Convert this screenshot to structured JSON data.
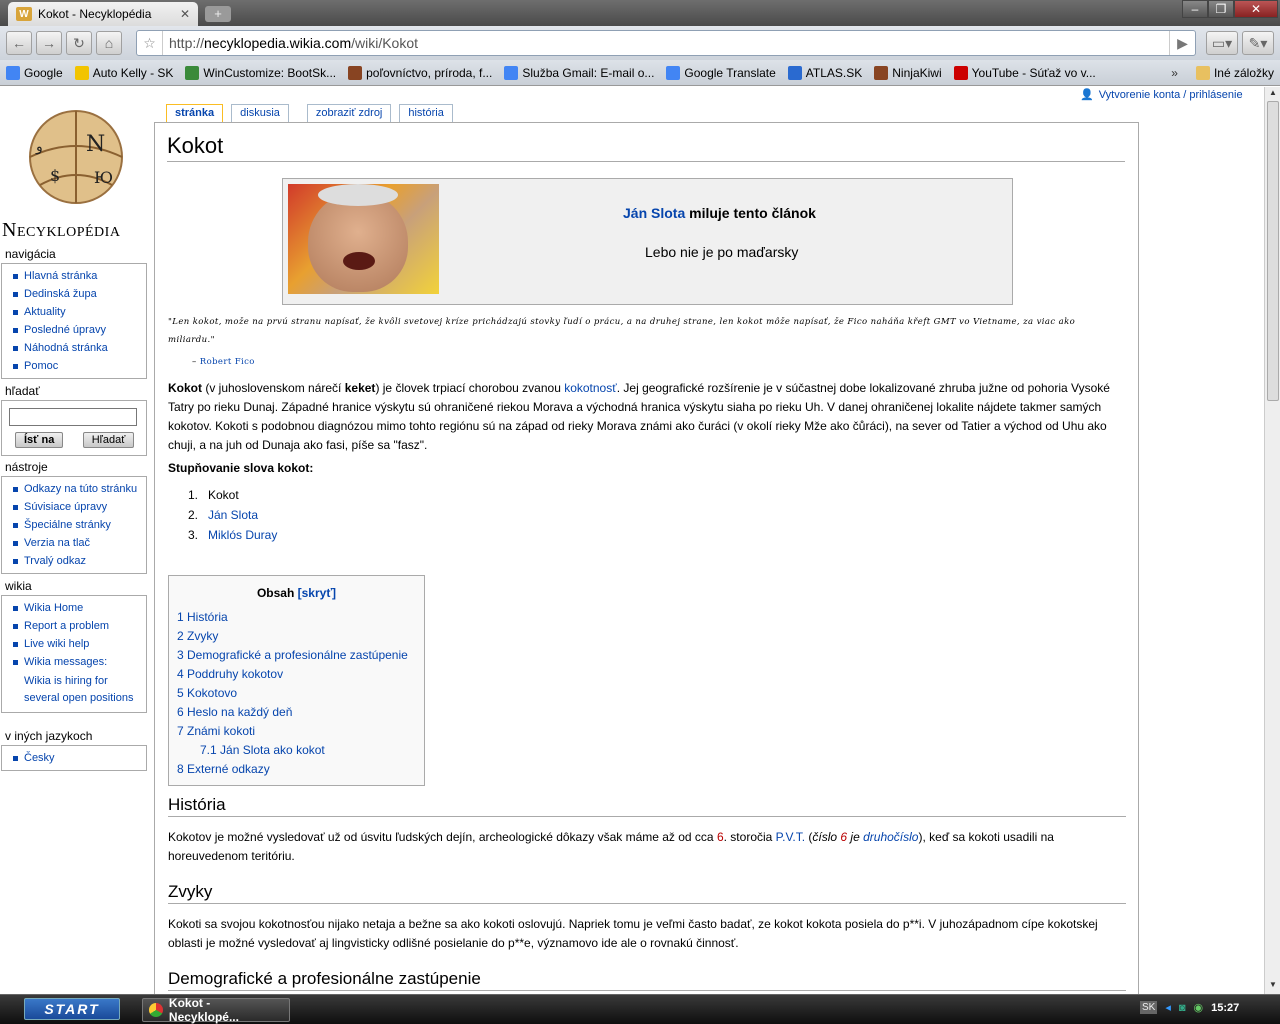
{
  "browser": {
    "tab_title": "Kokot - Necyklopédia",
    "tab_favicon": "W",
    "url_prefix": "http://",
    "url_domain": "necyklopedia.wikia.com",
    "url_path": "/wiki/Kokot"
  },
  "bookmarks": [
    {
      "label": "Google",
      "color": "#4285f4"
    },
    {
      "label": "Auto Kelly - SK",
      "color": "#f2c400"
    },
    {
      "label": "WinCustomize: BootSk...",
      "color": "#3a8a3a"
    },
    {
      "label": "poľovníctvo, príroda, f...",
      "color": "#884422"
    },
    {
      "label": "Služba Gmail: E-mail o...",
      "color": "#4285f4"
    },
    {
      "label": "Google Translate",
      "color": "#4285f4"
    },
    {
      "label": "ATLAS.SK",
      "color": "#2a6ad0"
    },
    {
      "label": "NinjaKiwi",
      "color": "#884422"
    },
    {
      "label": "YouTube - Súťaž vo v...",
      "color": "#cc0000"
    }
  ],
  "bookmarks_other": "Iné záložky",
  "user_links": "Vytvorenie konta / prihlásenie",
  "logo_text": "Necyklopédia",
  "sidebar": {
    "nav_title": "navigácia",
    "nav_items": [
      "Hlavná stránka",
      "Dedinská župa",
      "Aktuality",
      "Posledné úpravy",
      "Náhodná stránka",
      "Pomoc"
    ],
    "search_title": "hľadať",
    "search_go": "Ísť na",
    "search_find": "Hľadať",
    "tools_title": "nástroje",
    "tools_items": [
      "Odkazy na túto stránku",
      "Súvisiace úpravy",
      "Špeciálne stránky",
      "Verzia na tlač",
      "Trvalý odkaz"
    ],
    "wikia_title": "wikia",
    "wikia_items": [
      "Wikia Home",
      "Report a problem",
      "Live wiki help",
      "Wikia messages:"
    ],
    "wikia_msg": "Wikia is hiring for several open positions",
    "lang_title": "v iných jazykoch",
    "lang_items": [
      "Česky"
    ]
  },
  "tabs": [
    "stránka",
    "diskusia",
    "zobraziť zdroj",
    "história"
  ],
  "article": {
    "title": "Kokot",
    "box_link": "Ján Slota",
    "box_rest": " miluje tento článok",
    "box_sub": "Lebo nie je po maďarsky",
    "quote": "\"Len kokot, može na prvú stranu napísať, že kvôli svetovej kríze prichádzajú stovky ľudí o prácu, a na druhej strane, len kokot môže napísať, že Fico naháňa křeft GMT vo Vietname, za viac ako miliardu.\"",
    "quote_dash": "– ",
    "quote_author": "Robert Fico",
    "p1_bold1": "Kokot",
    "p1_a": " (v juhoslovenskom nárečí ",
    "p1_bold2": "keket",
    "p1_b": ") je človek trpiací chorobou zvanou ",
    "p1_link": "kokotnosť",
    "p1_c": ". Jej geografické rozšírenie je v súčastnej dobe lokalizované zhruba južne od pohoria Vysoké Tatry po rieku Dunaj. Západné hranice výskytu sú ohraničené riekou Morava a východná hranica výskytu siaha po rieku Uh. V danej ohraničenej lokalite nájdete takmer samých kokotov. Kokoti s podobnou diagnózou mimo tohto regiónu sú na západ od rieky Morava známi ako čuráci (v okolí rieky Mže ako čůráci), na sever od Tatier a východ od Uhu ako chuji, a na juh od Dunaja ako fasi, píše sa \"fasz\".",
    "subhead": "Stupňovanie slova kokot:",
    "list": [
      {
        "n": "1.",
        "t": "Kokot",
        "link": false
      },
      {
        "n": "2.",
        "t": "Ján Slota",
        "link": true
      },
      {
        "n": "3.",
        "t": "Miklós Duray",
        "link": true
      }
    ],
    "toc_title": "Obsah",
    "toc_hide": "[skryť]",
    "toc": [
      {
        "t": "1 História",
        "sub": false
      },
      {
        "t": "2 Zvyky",
        "sub": false
      },
      {
        "t": "3 Demografické a profesionálne zastúpenie",
        "sub": false
      },
      {
        "t": "4 Poddruhy kokotov",
        "sub": false
      },
      {
        "t": "5 Kokotovo",
        "sub": false
      },
      {
        "t": "6 Heslo na každý deň",
        "sub": false
      },
      {
        "t": "7 Známi kokoti",
        "sub": false
      },
      {
        "t": "7.1 Ján Slota ako kokot",
        "sub": true
      },
      {
        "t": "8 Externé odkazy",
        "sub": false
      }
    ],
    "h_historia": "História",
    "historia_a": "Kokotov je možné vysledovať už od úsvitu ľudských dejín, archeologické dôkazy však máme až od cca ",
    "historia_n6": "6",
    "historia_b": ". storočia ",
    "historia_pvt": "P.V.T.",
    "historia_c": " (",
    "historia_cislo": "číslo ",
    "historia_n6b": "6",
    "historia_d": " je ",
    "historia_druho": "druhočíslo",
    "historia_e": "), keď sa kokoti usadili na horeuvedenom teritóriu.",
    "h_zvyky": "Zvyky",
    "zvyky": "Kokoti sa svojou kokotnosťou nijako netaja a bežne sa ako kokoti oslovujú. Napriek tomu je veľmi často badať, ze kokot kokota posiela do p**i. V juhozápadnom cípe kokotskej oblasti je možné vysledovať aj lingvisticky odlišné posielanie do p**e, významovo ide ale o rovnakú činnosť.",
    "h_demo": "Demografické a profesionálne zastúpenie"
  },
  "taskbar": {
    "start": "START",
    "item": "Kokot - Necyklopé...",
    "lang": "SK",
    "time": "15:27"
  }
}
